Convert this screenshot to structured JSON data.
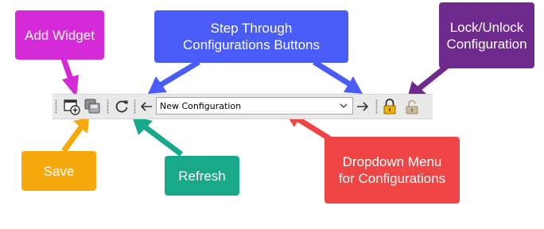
{
  "callouts": {
    "add_widget": "Add Widget",
    "step_through": "Step Through\nConfigurations Buttons",
    "lock_unlock": "Lock/Unlock\nConfiguration",
    "save": "Save",
    "refresh": "Refresh",
    "dropdown_menu": "Dropdown Menu\nfor Configurations"
  },
  "toolbar": {
    "config_select_value": "New Configuration",
    "icons": [
      "add-widget-icon",
      "save-icon",
      "refresh-icon",
      "arrow-left-icon",
      "chevron-down-icon",
      "arrow-right-icon",
      "lock-icon",
      "unlock-icon"
    ]
  },
  "colors": {
    "add_widget": "#d42ad8",
    "step_through": "#4a5cf7",
    "lock_unlock": "#6e2a8c",
    "save": "#f5a90a",
    "refresh": "#18a98a",
    "dropdown_menu": "#f04545",
    "lock_gold": "#f0b400"
  }
}
